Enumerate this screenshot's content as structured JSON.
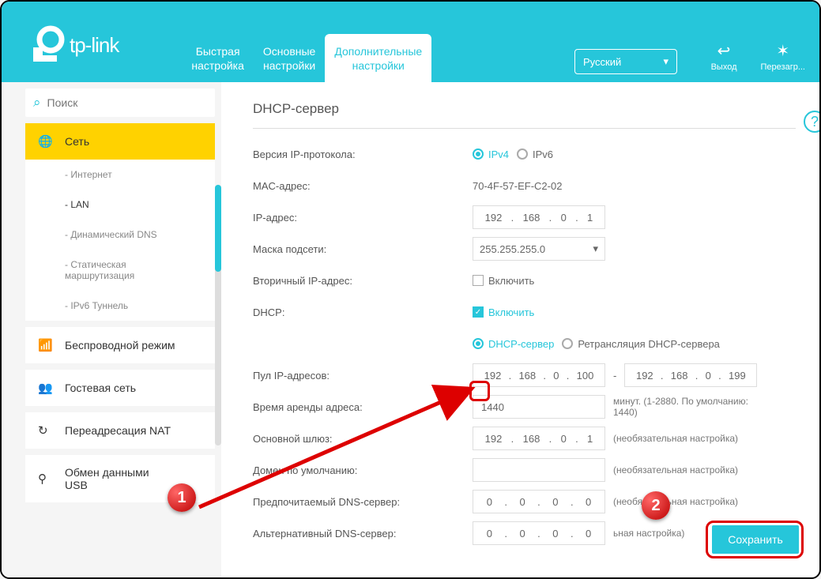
{
  "brand": "tp-link",
  "tabs": {
    "quick": "Быстрая\nнастройка",
    "basic": "Основные\nнастройки",
    "advanced": "Дополнительные\nнастройки"
  },
  "language": "Русский",
  "actions": {
    "logout": "Выход",
    "reload": "Перезагр..."
  },
  "search_placeholder": "Поиск",
  "sidebar": {
    "network": "Сеть",
    "subs": {
      "internet": "- Интернет",
      "lan": "- LAN",
      "ddns": "- Динамический DNS",
      "staticroute": "- Статическая\n  маршрутизация",
      "ipv6tun": "- IPv6 Туннель"
    },
    "wireless": "Беспроводной режим",
    "guest": "Гостевая сеть",
    "nat": "Переадресация NAT",
    "usb": "Обмен данными\nUSB"
  },
  "page": {
    "title": "DHCP-сервер",
    "labels": {
      "ipver": "Версия IP-протокола:",
      "mac": "MAC-адрес:",
      "ip": "IP-адрес:",
      "mask": "Маска подсети:",
      "ip2": "Вторичный IP-адрес:",
      "dhcp": "DHCP:",
      "pool": "Пул IP-адресов:",
      "lease": "Время аренды адреса:",
      "gw": "Основной шлюз:",
      "domain": "Домен по умолчанию:",
      "dns1": "Предпочитаемый DNS-сервер:",
      "dns2": "Альтернативный DNS-сервер:"
    },
    "radios": {
      "ipv4": "IPv4",
      "ipv6": "IPv6",
      "dhcpserver": "DHCP-сервер",
      "dhcprelay": "Ретрансляция DHCP-сервера"
    },
    "checks": {
      "enable": "Включить"
    },
    "values": {
      "mac": "70-4F-57-EF-C2-02",
      "ip": [
        "192",
        "168",
        "0",
        "1"
      ],
      "mask": "255.255.255.0",
      "pool_from": [
        "192",
        "168",
        "0",
        "100"
      ],
      "pool_to": [
        "192",
        "168",
        "0",
        "199"
      ],
      "lease": "1440",
      "gw": [
        "192",
        "168",
        "0",
        "1"
      ],
      "dns1": [
        "0",
        "0",
        "0",
        "0"
      ],
      "dns2": [
        "0",
        "0",
        "0",
        "0"
      ]
    },
    "hints": {
      "lease": "минут. (1-2880. По умолчанию: 1440)",
      "optional": "(необязательная настройка)",
      "optional_cut": "ьная настройка)"
    },
    "save": "Сохранить"
  },
  "annotations": {
    "one": "1",
    "two": "2"
  }
}
